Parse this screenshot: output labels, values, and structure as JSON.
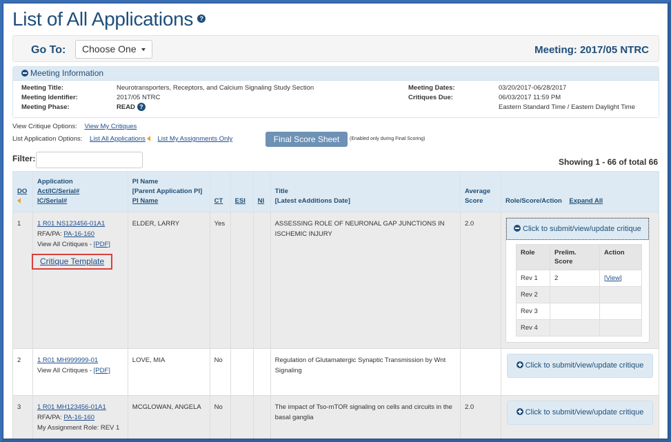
{
  "page": {
    "title": "List of All Applications",
    "help_icon": "question-circle-icon"
  },
  "goto": {
    "label": "Go To:",
    "select_value": "Choose One",
    "meeting_header": "Meeting: 2017/05 NTRC"
  },
  "meeting_info": {
    "heading": "Meeting Information",
    "left": [
      {
        "label": "Meeting Title:",
        "value": "Neurotransporters, Receptors, and Calcium Signaling Study Section"
      },
      {
        "label": "Meeting Identifier:",
        "value": "2017/05 NTRC"
      },
      {
        "label": "Meeting Phase:",
        "value": "READ"
      }
    ],
    "right": [
      {
        "label": "Meeting Dates:",
        "value": "03/20/2017-06/28/2017"
      },
      {
        "label": "Critiques Due:",
        "value": "06/03/2017 11:59 PM"
      },
      {
        "label": "",
        "value": "Eastern Standard Time / Eastern Daylight Time"
      }
    ]
  },
  "options": {
    "view_critique_label": "View Critique Options:",
    "view_my_critiques": "View My Critiques",
    "list_app_label": "List Application Options:",
    "list_all": "List All Applications",
    "list_mine": "List My Assignments Only",
    "final_score_sheet": "Final Score Sheet",
    "final_score_note": "(Enabled only during Final Scoring)"
  },
  "filter": {
    "label": "Filter:",
    "value": "",
    "placeholder": ""
  },
  "showing": "Showing 1 - 66 of total 66",
  "table": {
    "headers": {
      "do": "DO",
      "app_line1": "Application",
      "app_line2": "Act/IC/Serial#",
      "app_line3": "IC/Serial#",
      "pi_line1": "PI Name",
      "pi_line2": "[Parent Application PI]",
      "pi_line3": "PI Name",
      "ct": "CT",
      "esi": "ESI",
      "ni": "NI",
      "title_line1": "Title",
      "title_line2": "[Latest eAdditions Date]",
      "avg_line1": "Average",
      "avg_line2": "Score",
      "role": "Role/Score/Action",
      "expand_all": "Expand All"
    },
    "rows": [
      {
        "do": "1",
        "app_id": "1 R01 NS123456-01A1",
        "rfa_label": "RFA/PA:",
        "rfa": "PA-16-160",
        "view_all": "View All Critiques -",
        "pdf": "[PDF]",
        "critique_template": "Critique Template",
        "pi": "ELDER, LARRY",
        "ct": "Yes",
        "esi": "",
        "ni": "",
        "title": "ASSESSING ROLE OF NEURONAL GAP JUNCTIONS IN ISCHEMIC INJURY",
        "avg": "2.0",
        "critique_btn": "Click to submit/view/update critique",
        "roles_headers": {
          "role": "Role",
          "score_line1": "Prelim.",
          "score_line2": "Score",
          "action": "Action"
        },
        "roles": [
          {
            "role": "Rev 1",
            "score": "2",
            "action": "[View]"
          },
          {
            "role": "Rev 2",
            "score": "",
            "action": ""
          },
          {
            "role": "Rev 3",
            "score": "",
            "action": ""
          },
          {
            "role": "Rev 4",
            "score": "",
            "action": ""
          }
        ]
      },
      {
        "do": "2",
        "app_id": "1 R01 MH999999-01",
        "view_all": "View All Critiques -",
        "pdf": "[PDF]",
        "pi": "LOVE, MIA",
        "ct": "No",
        "esi": "",
        "ni": "",
        "title": "Regulation of Glutamatergic Synaptic Transmission by Wnt Signaling",
        "avg": "",
        "critique_btn": "Click to submit/view/update critique"
      },
      {
        "do": "3",
        "app_id": "1 R01 MH123456-01A1",
        "rfa_label": "RFA/PA:",
        "rfa": "PA-16-160",
        "assignment": "My Assignment Role: REV 1",
        "pi": "MCGLOWAN, ANGELA",
        "ct": "No",
        "esi": "",
        "ni": "",
        "title": "The impact of Tso-mTOR signaling on cells and circuits in the basal ganglia",
        "avg": "2.0",
        "critique_btn": "Click to submit/view/update critique"
      }
    ]
  },
  "colors": {
    "brand_blue": "#1f4e79",
    "header_bg": "#deeaf3",
    "highlight_red": "#d9403a",
    "sort_arrow": "#f0a030",
    "frame": "#3a6fb5"
  }
}
